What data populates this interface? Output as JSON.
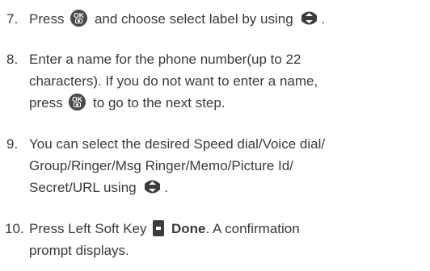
{
  "steps": [
    {
      "number": "7.",
      "lines": [
        {
          "before": "Press",
          "after_ok": "and choose select label by using",
          "after_nav": "."
        }
      ]
    },
    {
      "number": "8.",
      "lines": [
        "Enter a name for the phone number(up to 22",
        "characters). If you do not want to enter a name,",
        {
          "before": "press",
          "after_ok": "to go to the next step."
        }
      ]
    },
    {
      "number": "9.",
      "lines": [
        "You can select the desired Speed dial/Voice dial/",
        "Group/Ringer/Msg Ringer/Memo/Picture Id/",
        {
          "before": "Secret/URL using",
          "after_nav": "."
        }
      ]
    },
    {
      "number": "10.",
      "lines": [
        {
          "before": "Press Left Soft Key",
          "bold": "Done",
          "after_bold": ". A confirmation"
        },
        "prompt displays."
      ]
    }
  ],
  "icons": {
    "ok_key": "ok-camera-key-icon",
    "nav_key": "navigation-key-icon",
    "soft_key": "left-soft-key-icon",
    "ok_label": "OK"
  }
}
